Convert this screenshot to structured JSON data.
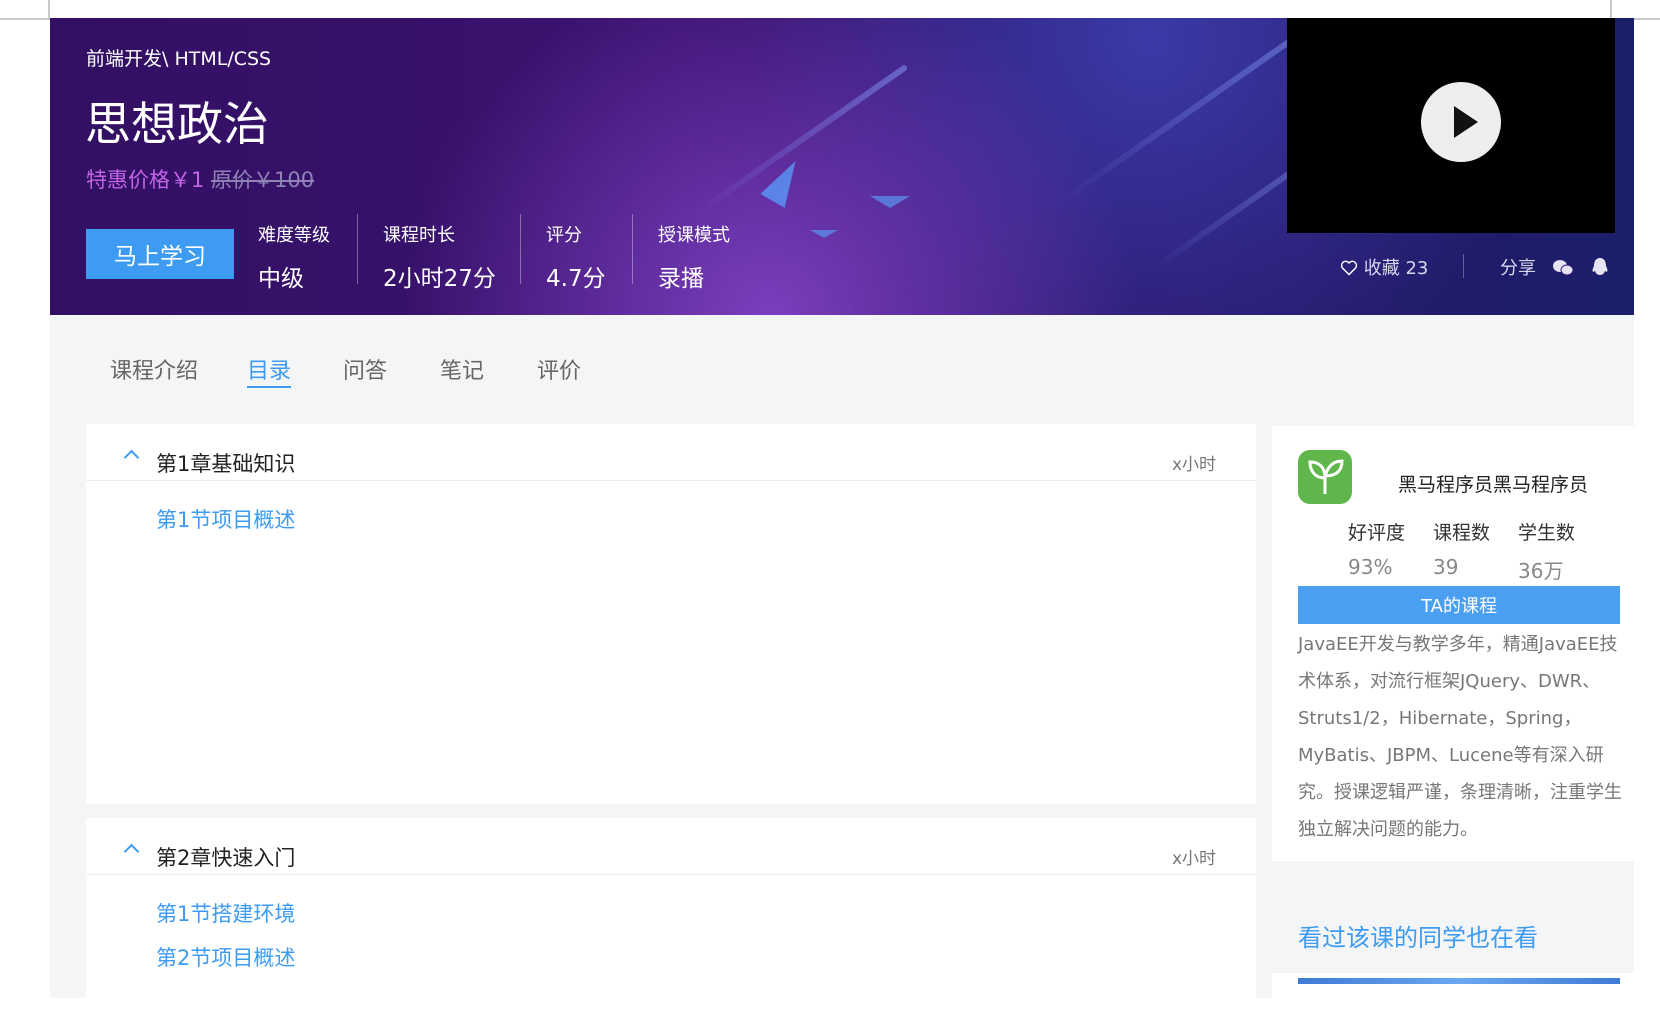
{
  "hero": {
    "breadcrumb": "前端开发\\ HTML/CSS",
    "title": "思想政治",
    "price_special": "特惠价格￥1",
    "price_original": "原价￥100",
    "learn_button": "马上学习",
    "stats": [
      {
        "label": "难度等级",
        "value": "中级"
      },
      {
        "label": "课程时长",
        "value": "2小时27分"
      },
      {
        "label": "评分",
        "value": "4.7分"
      },
      {
        "label": "授课模式",
        "value": "录播"
      }
    ],
    "favorite": "收藏 23",
    "share": "分享"
  },
  "tabs": [
    "课程介绍",
    "目录",
    "问答",
    "笔记",
    "评价"
  ],
  "active_tab": "目录",
  "chapters": [
    {
      "title": "第1章基础知识",
      "time": "x小时",
      "lessons": [
        "第1节项目概述"
      ]
    },
    {
      "title": "第2章快速入门",
      "time": "x小时",
      "lessons": [
        "第1节搭建环境",
        "第2节项目概述"
      ]
    }
  ],
  "teacher": {
    "name": "黑马程序员黑马程序员",
    "stats": [
      {
        "label": "好评度",
        "value": "93%"
      },
      {
        "label": "课程数",
        "value": "39"
      },
      {
        "label": "学生数",
        "value": "36万"
      }
    ],
    "courses_button": "TA的课程",
    "bio": "JavaEE开发与教学多年，精通JavaEE技术体系，对流行框架JQuery、DWR、Struts1/2，Hibernate，Spring，MyBatis、JBPM、Lucene等有深入研究。授课逻辑严谨，条理清晰，注重学生独立解决问题的能力。"
  },
  "also_watching": {
    "title": "看过该课的同学也在看"
  },
  "colors": {
    "accent": "#3d9bf2",
    "price": "#c163e6",
    "hero_dark": "#321063"
  }
}
